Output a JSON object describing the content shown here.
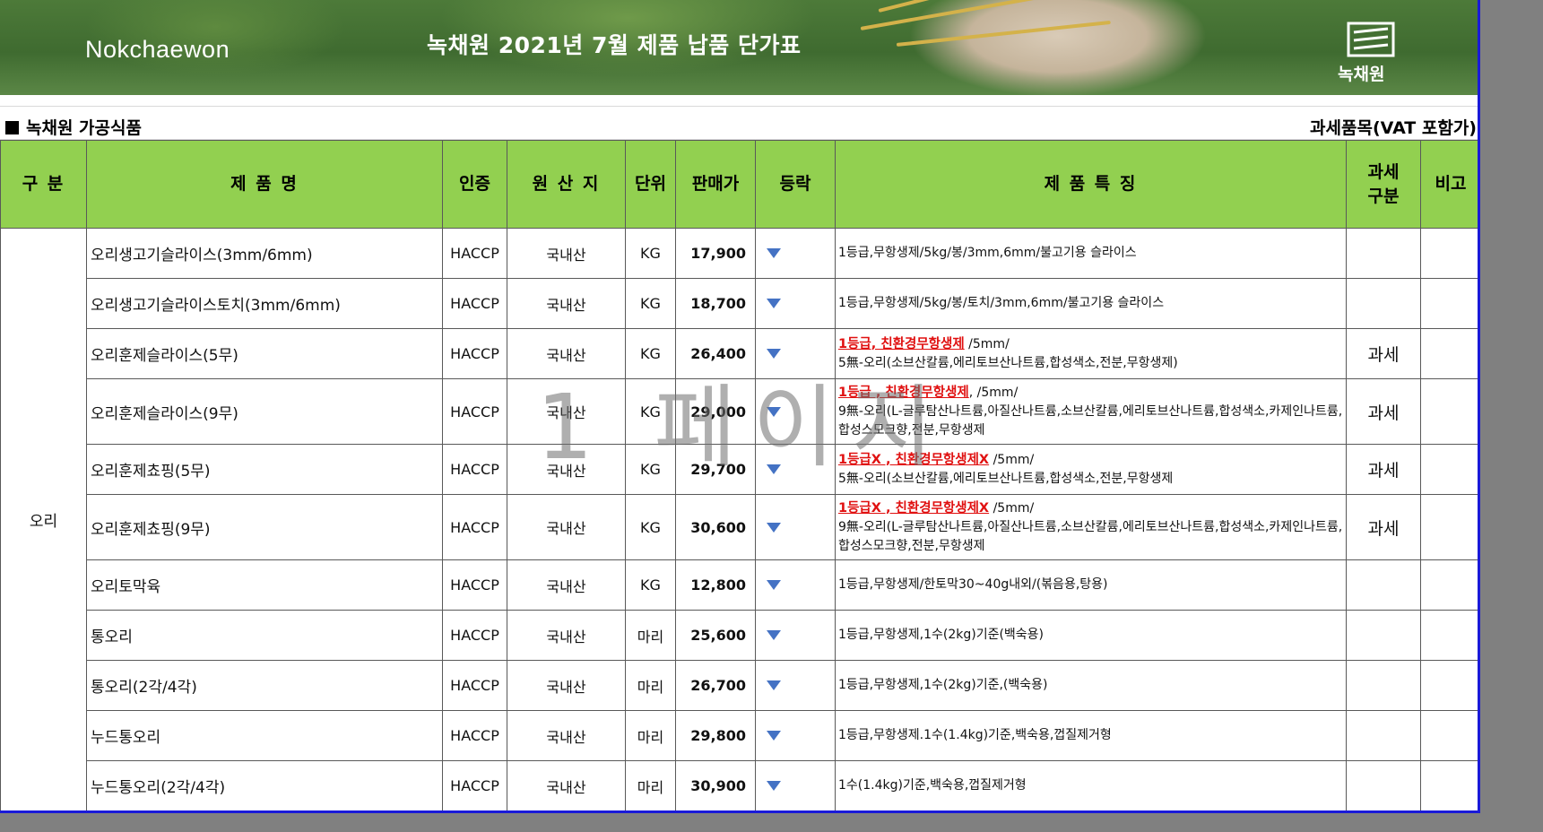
{
  "banner": {
    "brand_en": "Nokchaewon",
    "title": "녹채원 2021년 7월 제품 납품 단가표",
    "logo_text": "녹채원"
  },
  "section": {
    "title": "녹채원 가공식품",
    "vat_note": "과세품목(VAT 포함가)"
  },
  "columns": {
    "category": "구 분",
    "name": "제 품 명",
    "cert": "인증",
    "origin": "원 산 지",
    "unit": "단위",
    "price": "판매가",
    "trend": "등락",
    "features": "제 품 특 징",
    "tax_line1": "과세",
    "tax_line2": "구분",
    "note": "비고"
  },
  "category": "오리",
  "rows": [
    {
      "name": "오리생고기슬라이스(3mm/6mm)",
      "cert": "HACCP",
      "origin": "국내산",
      "unit": "KG",
      "price": "17,900",
      "trend": "down-icon",
      "feat_hl": "",
      "feat_1": "1등급,무항생제/5kg/봉/3mm,6mm/불고기용 슬라이스",
      "feat_2": "",
      "tax": ""
    },
    {
      "name": "오리생고기슬라이스토치(3mm/6mm)",
      "cert": "HACCP",
      "origin": "국내산",
      "unit": "KG",
      "price": "18,700",
      "trend": "down-icon",
      "feat_hl": "",
      "feat_1": "1등급,무항생제/5kg/봉/토치/3mm,6mm/불고기용 슬라이스",
      "feat_2": "",
      "tax": ""
    },
    {
      "name": "오리훈제슬라이스(5무)",
      "cert": "HACCP",
      "origin": "국내산",
      "unit": "KG",
      "price": "26,400",
      "trend": "down-icon",
      "feat_hl": "1등급, 친환경무항생제",
      "feat_1": " /5mm/",
      "feat_2": "5無-오리(소브산칼륨,에리토브산나트륨,합성색소,전분,무항생제)",
      "tax": "과세"
    },
    {
      "name": "오리훈제슬라이스(9무)",
      "cert": "HACCP",
      "origin": "국내산",
      "unit": "KG",
      "price": "29,000",
      "trend": "down-icon",
      "feat_hl": "1등급 , 친환경무항생제",
      "feat_1": ", /5mm/",
      "feat_2": "9無-오리(L-글루탐산나트륨,아질산나트륨,소브산칼륨,에리토브산나트륨,합성색소,카제인나트륨,합성스모크향,전분,무항생제",
      "tax": "과세"
    },
    {
      "name": "오리훈제쵸핑(5무)",
      "cert": "HACCP",
      "origin": "국내산",
      "unit": "KG",
      "price": "29,700",
      "trend": "down-icon",
      "feat_hl": "1등급X , 친환경무항생제X",
      "feat_1": " /5mm/",
      "feat_2": "5無-오리(소브산칼륨,에리토브산나트륨,합성색소,전분,무항생제",
      "tax": "과세"
    },
    {
      "name": "오리훈제쵸핑(9무)",
      "cert": "HACCP",
      "origin": "국내산",
      "unit": "KG",
      "price": "30,600",
      "trend": "down-icon",
      "feat_hl": "1등급X , 친환경무항생제X",
      "feat_1": " /5mm/",
      "feat_2": "9無-오리(L-글루탐산나트륨,아질산나트륨,소브산칼륨,에리토브산나트륨,합성색소,카제인나트륨,합성스모크향,전분,무항생제",
      "tax": "과세"
    },
    {
      "name": "오리토막육",
      "cert": "HACCP",
      "origin": "국내산",
      "unit": "KG",
      "price": "12,800",
      "trend": "down-icon",
      "feat_hl": "",
      "feat_1": "1등급,무항생제/한토막30~40g내외/(볶음용,탕용)",
      "feat_2": "",
      "tax": ""
    },
    {
      "name": "통오리",
      "cert": "HACCP",
      "origin": "국내산",
      "unit": "마리",
      "price": "25,600",
      "trend": "down-icon",
      "feat_hl": "",
      "feat_1": "1등급,무항생제,1수(2kg)기준(백숙용)",
      "feat_2": "",
      "tax": ""
    },
    {
      "name": "통오리(2각/4각)",
      "cert": "HACCP",
      "origin": "국내산",
      "unit": "마리",
      "price": "26,700",
      "trend": "down-icon",
      "feat_hl": "",
      "feat_1": "1등급,무항생제,1수(2kg)기준,(백숙용)",
      "feat_2": "",
      "tax": ""
    },
    {
      "name": "누드통오리",
      "cert": "HACCP",
      "origin": "국내산",
      "unit": "마리",
      "price": "29,800",
      "trend": "down-icon",
      "feat_hl": "",
      "feat_1": "1등급,무항생제.1수(1.4kg)기준,백숙용,껍질제거형",
      "feat_2": "",
      "tax": ""
    },
    {
      "name": "누드통오리(2각/4각)",
      "cert": "HACCP",
      "origin": "국내산",
      "unit": "마리",
      "price": "30,900",
      "trend": "down-icon",
      "feat_hl": "",
      "feat_1": "1수(1.4kg)기준,백숙용,껍질제거형",
      "feat_2": "",
      "tax": ""
    }
  ],
  "watermark": "1 페이지",
  "colors": {
    "header_green": "#92d050",
    "trend_blue": "#4472c4",
    "highlight_red": "#e01010",
    "page_border_blue": "#1a1ad8"
  }
}
